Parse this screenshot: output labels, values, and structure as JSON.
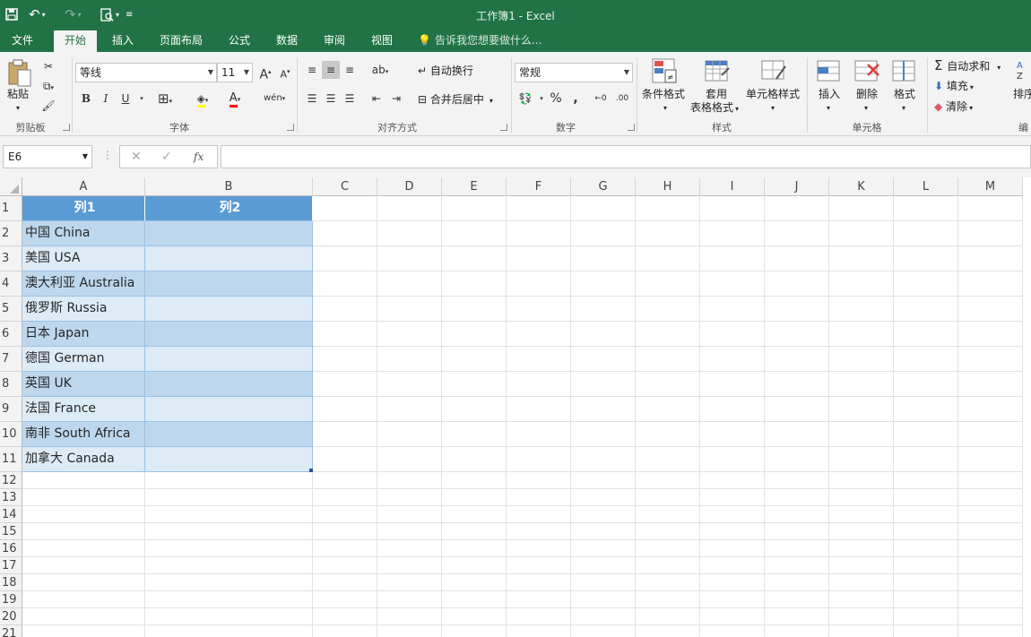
{
  "window": {
    "title": "工作簿1 - Excel"
  },
  "tabs": [
    {
      "id": "file",
      "label": "文件"
    },
    {
      "id": "home",
      "label": "开始",
      "active": true
    },
    {
      "id": "insert",
      "label": "插入"
    },
    {
      "id": "layout",
      "label": "页面布局"
    },
    {
      "id": "formulas",
      "label": "公式"
    },
    {
      "id": "data",
      "label": "数据"
    },
    {
      "id": "review",
      "label": "审阅"
    },
    {
      "id": "view",
      "label": "视图"
    }
  ],
  "tell_me": "告诉我您想要做什么...",
  "ribbon": {
    "clipboard": {
      "paste": "粘贴",
      "group": "剪贴板"
    },
    "font": {
      "name": "等线",
      "size": "11",
      "bold": "B",
      "italic": "I",
      "underline": "U",
      "group": "字体"
    },
    "alignment": {
      "wrap": "自动换行",
      "merge": "合并后居中",
      "group": "对齐方式"
    },
    "number": {
      "format": "常规",
      "percent": "%",
      "comma": ",",
      "group": "数字"
    },
    "styles": {
      "cond": "条件格式",
      "table1": "套用",
      "table2": "表格格式",
      "cell_styles": "单元格样式",
      "group": "样式"
    },
    "cells": {
      "insert": "插入",
      "delete": "删除",
      "format": "格式",
      "group": "单元格"
    },
    "editing": {
      "autosum": "自动求和",
      "fill": "填充",
      "clear": "清除",
      "sort": "排序",
      "group": "编"
    }
  },
  "formula_bar": {
    "name_box": "E6",
    "fx": "fx",
    "content": ""
  },
  "columns": [
    "A",
    "B",
    "C",
    "D",
    "E",
    "F",
    "G",
    "H",
    "I",
    "J",
    "K",
    "L",
    "M"
  ],
  "rows": [
    "1",
    "2",
    "3",
    "4",
    "5",
    "6",
    "7",
    "8",
    "9",
    "10",
    "11",
    "12",
    "13",
    "14",
    "15",
    "16",
    "17",
    "18",
    "19",
    "20",
    "21"
  ],
  "table": {
    "headers": [
      "列1",
      "列2"
    ],
    "rows": [
      [
        "中国 China",
        ""
      ],
      [
        "美国 USA",
        ""
      ],
      [
        "澳大利亚 Australia",
        ""
      ],
      [
        "俄罗斯 Russia",
        ""
      ],
      [
        "日本 Japan",
        ""
      ],
      [
        "德国 German",
        ""
      ],
      [
        "英国 UK",
        ""
      ],
      [
        "法国 France",
        ""
      ],
      [
        "南非 South Africa",
        ""
      ],
      [
        "加拿大 Canada",
        ""
      ]
    ],
    "colors": {
      "header": "#5b9bd5",
      "band_dark": "#bdd7ee",
      "band_light": "#ddebf7"
    }
  },
  "colors": {
    "accent": "#217346"
  }
}
